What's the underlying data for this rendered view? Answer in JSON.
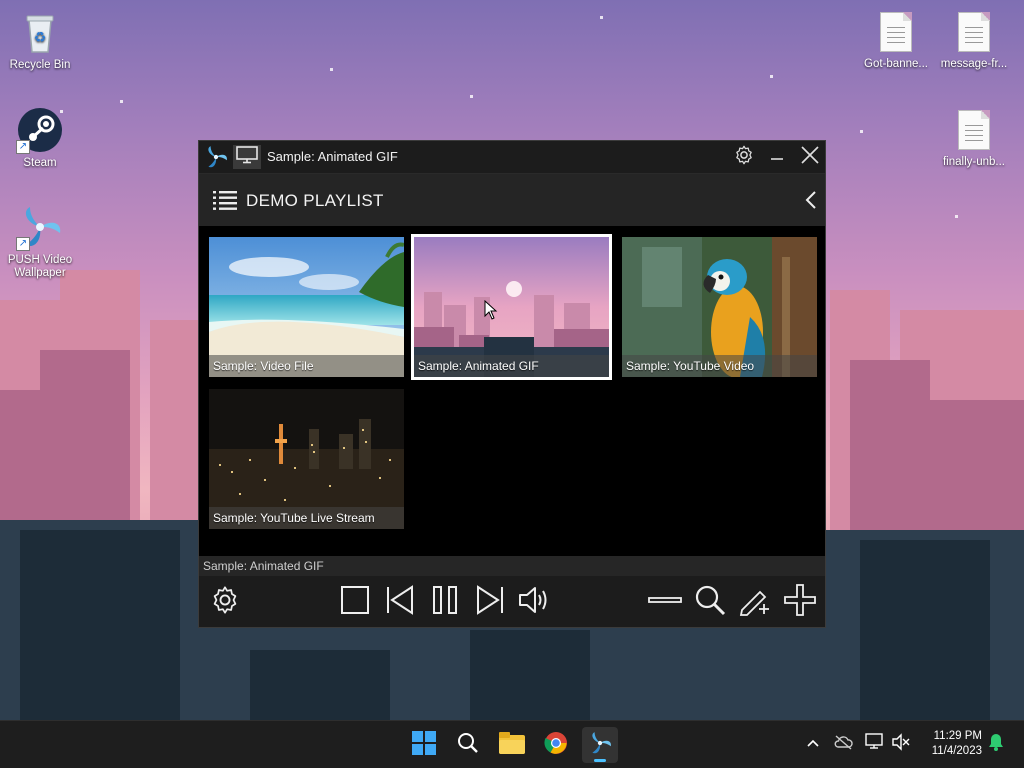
{
  "desktop": {
    "icons": [
      {
        "label": "Recycle Bin",
        "icon": "recycle-bin-icon"
      },
      {
        "label": "Steam",
        "icon": "steam-icon"
      },
      {
        "label": "PUSH Video Wallpaper",
        "icon": "push-video-wallpaper-icon"
      },
      {
        "label": "Got-banne...",
        "icon": "text-file-icon"
      },
      {
        "label": "message-fr...",
        "icon": "text-file-icon"
      },
      {
        "label": "finally-unb...",
        "icon": "text-file-icon"
      }
    ]
  },
  "app": {
    "title": "Sample: Animated GIF",
    "playlist_title": "DEMO PLAYLIST",
    "items": [
      {
        "caption": "Sample: Video File",
        "selected": false
      },
      {
        "caption": "Sample: Animated GIF",
        "selected": true
      },
      {
        "caption": "Sample: YouTube Video",
        "selected": false
      },
      {
        "caption": "Sample: YouTube Live Stream",
        "selected": false
      }
    ],
    "status": "Sample: Animated GIF",
    "controls": [
      "settings-icon",
      "stop-icon",
      "previous-icon",
      "pause-icon",
      "next-icon",
      "volume-icon",
      "remove-icon",
      "search-icon",
      "edit-add-icon",
      "add-icon"
    ]
  },
  "taskbar": {
    "apps": [
      "windows-start-icon",
      "search-icon",
      "file-explorer-icon",
      "chrome-icon",
      "push-video-wallpaper-icon"
    ],
    "tray": [
      "chevron-up-icon",
      "cloud-off-icon",
      "network-icon",
      "volume-muted-icon",
      "notification-bell-icon"
    ],
    "time": "11:29 PM",
    "date": "11/4/2023"
  },
  "colors": {
    "accent": "#4cc2ff",
    "selection": "#ffffff",
    "window_bg": "#000000",
    "header_bg": "#252525",
    "notification": "#2ecc71"
  }
}
